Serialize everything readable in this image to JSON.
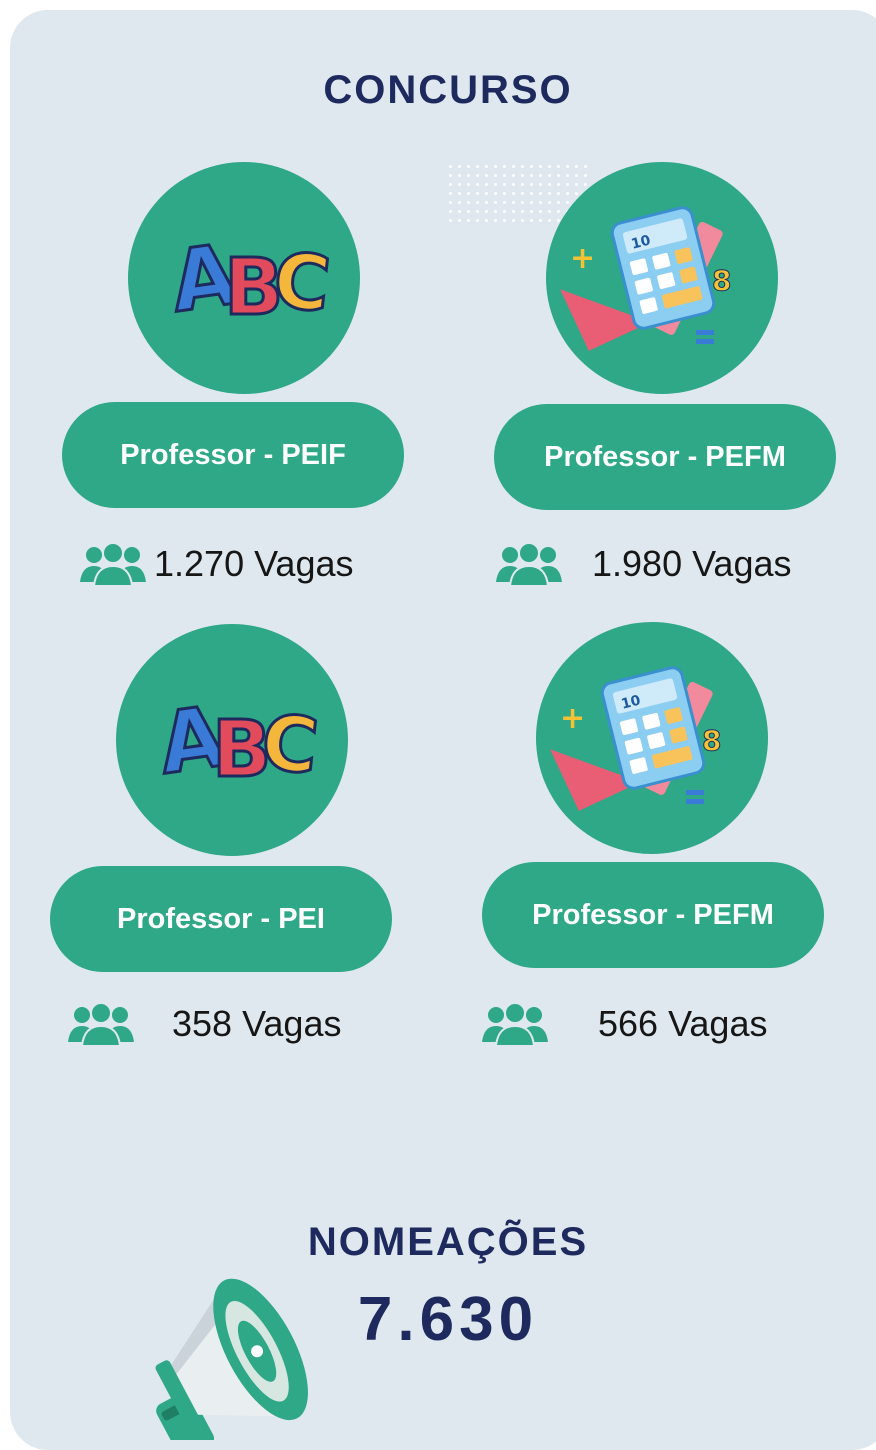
{
  "header": {
    "title": "CONCURSO"
  },
  "colors": {
    "accent": "#2ea887",
    "title": "#1e2a5e",
    "background": "#dfe8ee"
  },
  "positions": [
    {
      "label": "Professor - PEIF",
      "vagas": "1.270 Vagas",
      "illustration": "abc-letters-icon"
    },
    {
      "label": "Professor - PEFM",
      "vagas": "1.980 Vagas",
      "illustration": "calculator-icon"
    },
    {
      "label": "Professor - PEI",
      "vagas": "358 Vagas",
      "illustration": "abc-letters-icon"
    },
    {
      "label": "Professor - PEFM",
      "vagas": "566 Vagas",
      "illustration": "calculator-icon"
    }
  ],
  "summary": {
    "label": "NOMEAÇÕES",
    "total": "7.630",
    "icon": "megaphone-icon"
  }
}
